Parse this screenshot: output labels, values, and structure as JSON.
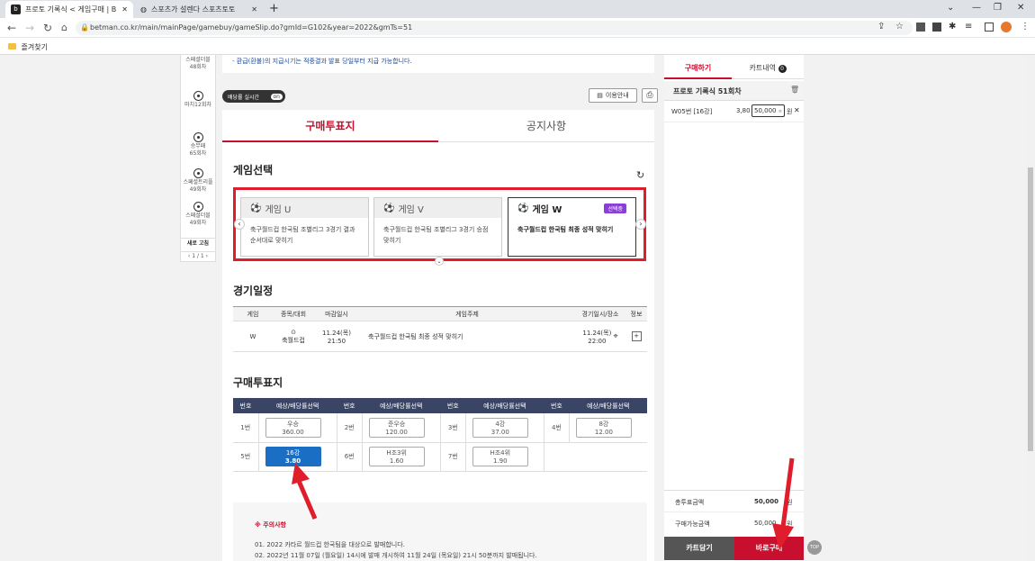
{
  "browser": {
    "tabs": [
      {
        "title": "프로토 기록식 < 게임구매 | BET",
        "favicon": "b"
      },
      {
        "title": "스포츠가 설렌다 스포츠토토",
        "favicon": "globe-icon"
      }
    ],
    "new_tab": "+",
    "url": "betman.co.kr/main/mainPage/gamebuy/gameSlip.do?gmId=G102&year=2022&gmTs=51",
    "bookmark_folder": "즐겨찾기"
  },
  "leftnav": {
    "items": [
      {
        "label": "스페셜더블\n48회차"
      },
      {
        "label": "마치12회차"
      },
      {
        "label": "승무패\n65회차"
      },
      {
        "label": "스페셜트리플\n49회차"
      },
      {
        "label": "스페셜더블\n49회차"
      }
    ],
    "refresh": "새로 고침",
    "pager": "1 / 1"
  },
  "notice_top": "- 환급(환불)의 지급시기는 적중결과 발표 당일부터 지급 가능합니다.",
  "toggle": {
    "label": "배당률 실시간",
    "state": "on"
  },
  "guide_button": "이용안내",
  "main_tabs": [
    "구매투표지",
    "공지사항"
  ],
  "game_select": {
    "title": "게임선택",
    "cards": [
      {
        "name": "게임 U",
        "desc": "축구월드컵 한국팀 조별리그 3경기 결과 순서대로 맞히기",
        "selected": false
      },
      {
        "name": "게임 V",
        "desc": "축구월드컵 한국팀 조별리그 3경기 승점 맞히기",
        "selected": false
      },
      {
        "name": "게임 W",
        "desc": "축구월드컵 한국팀 최종 성적 맞히기",
        "selected": true,
        "badge": "선택중"
      }
    ]
  },
  "schedule": {
    "title": "경기일정",
    "headers": [
      "게임",
      "종목/대회",
      "마감일시",
      "게임주제",
      "경기일시/장소",
      "정보"
    ],
    "row": {
      "game": "W",
      "sport": "축월드컵",
      "deadline_date": "11.24(목)",
      "deadline_time": "21:50",
      "topic": "축구월드컵 한국팀 최종 성적 맞히기",
      "match_date": "11.24(목)",
      "match_time": "22:00",
      "info": "+"
    }
  },
  "slip": {
    "title": "구매투표지",
    "header_num": "번호",
    "header_opt": "예상/배당률선택",
    "options": [
      {
        "num": "1번",
        "label": "우승",
        "odds": "360.00",
        "selected": false
      },
      {
        "num": "2번",
        "label": "준우승",
        "odds": "120.00",
        "selected": false
      },
      {
        "num": "3번",
        "label": "4강",
        "odds": "37.00",
        "selected": false
      },
      {
        "num": "4번",
        "label": "8강",
        "odds": "12.00",
        "selected": false
      },
      {
        "num": "5번",
        "label": "16강",
        "odds": "3.80",
        "selected": true
      },
      {
        "num": "6번",
        "label": "H조3위",
        "odds": "1.60",
        "selected": false
      },
      {
        "num": "7번",
        "label": "H조4위",
        "odds": "1.90",
        "selected": false
      }
    ]
  },
  "caution": {
    "title": "※ 주의사항",
    "lines": [
      "01. 2022 카타르 월드컵 한국팀을 대상으로 발매합니다.",
      "02. 2022년 11월 07일 (월요일) 14시에 발매 개시하여 11월 24일 (목요일) 21시 50분까지 발매됩니다."
    ]
  },
  "right_panel": {
    "tab_buy": "구매하기",
    "tab_cart": "카트내역",
    "cart_count": "0",
    "game_title": "프로토 기록식 51회차",
    "slip_item": {
      "label": "W05번 [16강]",
      "odds": "3,80",
      "amount": "50,000",
      "unit": "원"
    },
    "total_label": "총투표금액",
    "total_value": "50,000",
    "total_unit": "원",
    "available_label": "구매가능금액",
    "available_value": "50,000",
    "available_unit": "원",
    "cart_button": "카트담기",
    "buy_button": "바로구매",
    "top_button": "TOP"
  },
  "colors": {
    "accent_red": "#c8102e",
    "badge_purple": "#8b3fd9",
    "select_blue": "#1a6fc4",
    "arrow_red": "#e01e2b",
    "header_navy": "#3a4565"
  }
}
